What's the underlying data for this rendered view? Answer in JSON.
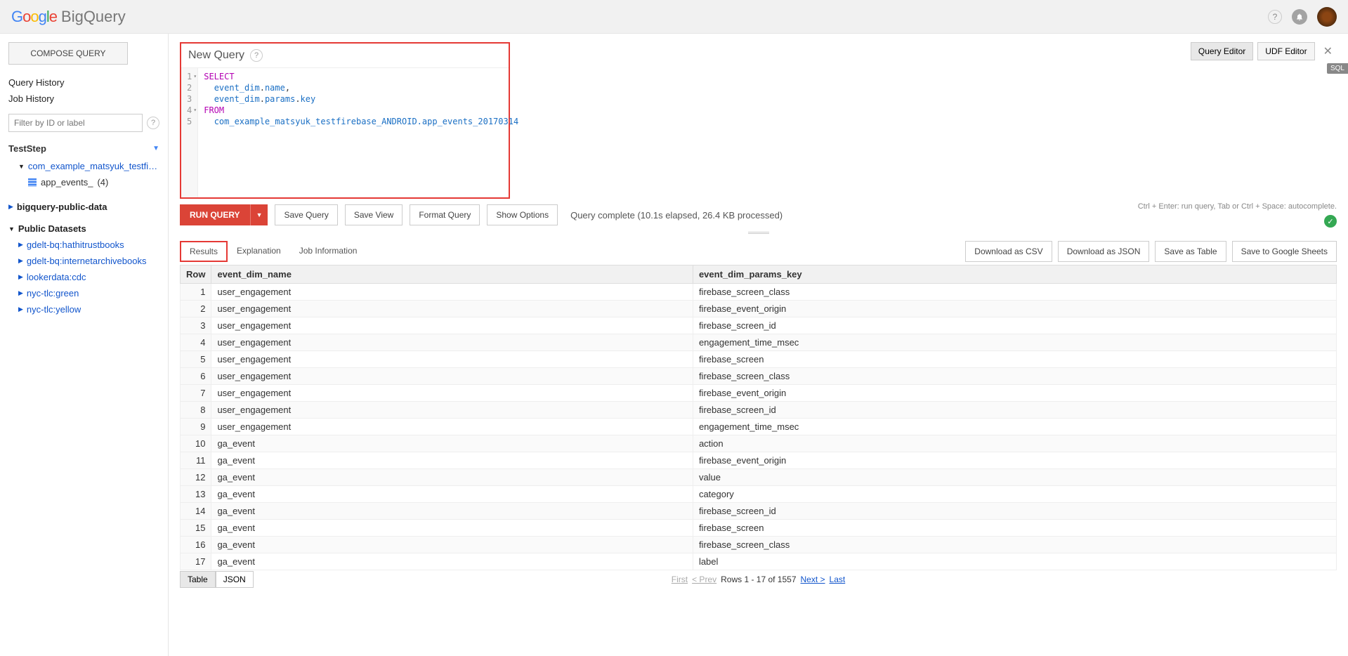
{
  "header": {
    "product": "BigQuery"
  },
  "sidebar": {
    "compose": "COMPOSE QUERY",
    "query_history": "Query History",
    "job_history": "Job History",
    "filter_placeholder": "Filter by ID or label",
    "project": "TestStep",
    "dataset": "com_example_matsyuk_testfireba...",
    "table": "app_events_",
    "table_count": "(4)",
    "public_project": "bigquery-public-data",
    "public_datasets_header": "Public Datasets",
    "public_datasets": [
      "gdelt-bq:hathitrustbooks",
      "gdelt-bq:internetarchivebooks",
      "lookerdata:cdc",
      "nyc-tlc:green",
      "nyc-tlc:yellow"
    ]
  },
  "query": {
    "title": "New Query",
    "tabs": {
      "editor": "Query Editor",
      "udf": "UDF Editor"
    },
    "sql_badge": "SQL",
    "code": {
      "l1": "SELECT",
      "l2a": "event_dim",
      "l2b": "name",
      "l3a": "event_dim",
      "l3b": "params",
      "l3c": "key",
      "l4": "FROM",
      "l5": "com_example_matsyuk_testfirebase_ANDROID.app_events_20170314"
    }
  },
  "actions": {
    "run": "RUN QUERY",
    "save_query": "Save Query",
    "save_view": "Save View",
    "format": "Format Query",
    "show_options": "Show Options",
    "status": "Query complete (10.1s elapsed, 26.4 KB processed)",
    "hint": "Ctrl + Enter: run query, Tab or Ctrl + Space: autocomplete."
  },
  "results": {
    "tabs": {
      "results": "Results",
      "explanation": "Explanation",
      "job_info": "Job Information"
    },
    "downloads": {
      "csv": "Download as CSV",
      "json": "Download as JSON",
      "table": "Save as Table",
      "sheets": "Save to Google Sheets"
    },
    "columns": {
      "row": "Row",
      "c1": "event_dim_name",
      "c2": "event_dim_params_key"
    },
    "rows": [
      {
        "n": "1",
        "c1": "user_engagement",
        "c2": "firebase_screen_class"
      },
      {
        "n": "2",
        "c1": "user_engagement",
        "c2": "firebase_event_origin"
      },
      {
        "n": "3",
        "c1": "user_engagement",
        "c2": "firebase_screen_id"
      },
      {
        "n": "4",
        "c1": "user_engagement",
        "c2": "engagement_time_msec"
      },
      {
        "n": "5",
        "c1": "user_engagement",
        "c2": "firebase_screen"
      },
      {
        "n": "6",
        "c1": "user_engagement",
        "c2": "firebase_screen_class"
      },
      {
        "n": "7",
        "c1": "user_engagement",
        "c2": "firebase_event_origin"
      },
      {
        "n": "8",
        "c1": "user_engagement",
        "c2": "firebase_screen_id"
      },
      {
        "n": "9",
        "c1": "user_engagement",
        "c2": "engagement_time_msec"
      },
      {
        "n": "10",
        "c1": "ga_event",
        "c2": "action"
      },
      {
        "n": "11",
        "c1": "ga_event",
        "c2": "firebase_event_origin"
      },
      {
        "n": "12",
        "c1": "ga_event",
        "c2": "value"
      },
      {
        "n": "13",
        "c1": "ga_event",
        "c2": "category"
      },
      {
        "n": "14",
        "c1": "ga_event",
        "c2": "firebase_screen_id"
      },
      {
        "n": "15",
        "c1": "ga_event",
        "c2": "firebase_screen"
      },
      {
        "n": "16",
        "c1": "ga_event",
        "c2": "firebase_screen_class"
      },
      {
        "n": "17",
        "c1": "ga_event",
        "c2": "label"
      }
    ],
    "view": {
      "table": "Table",
      "json": "JSON"
    },
    "pager": {
      "first": "First",
      "prev": "< Prev",
      "range": "Rows 1 - 17 of 1557",
      "next": "Next >",
      "last": "Last"
    }
  }
}
